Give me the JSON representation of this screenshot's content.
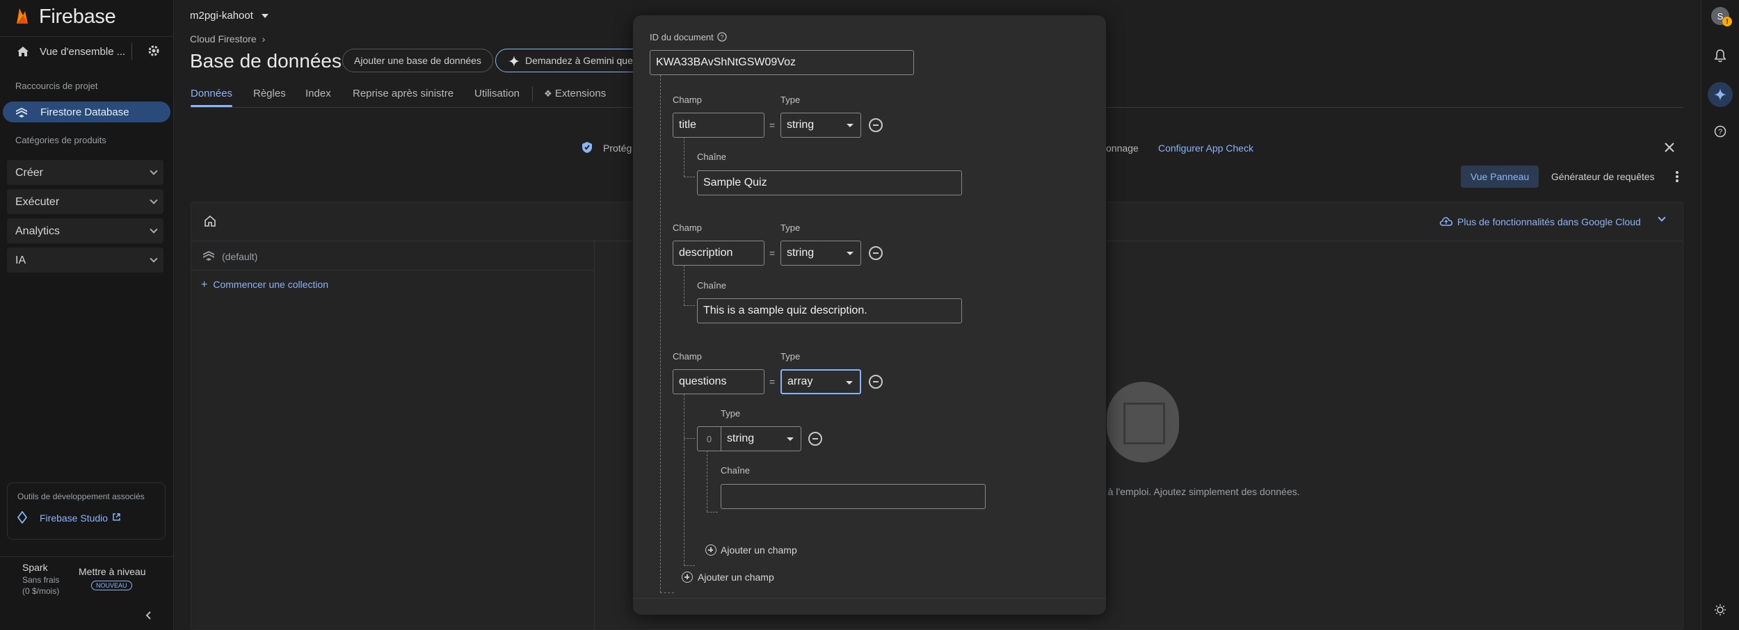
{
  "sidebar": {
    "logo": "Firebase",
    "overview": "Vue d'ensemble ...",
    "shortcuts_label": "Raccourcis de projet",
    "active_item": "Firestore Database",
    "categories_label": "Catégories de produits",
    "categories": [
      "Créer",
      "Exécuter",
      "Analytics",
      "IA"
    ],
    "dev_tools_label": "Outils de développement associés",
    "studio_link": "Firebase Studio",
    "plan_name": "Spark",
    "plan_price_1": "Sans frais",
    "plan_price_2": "(0 $/mois)",
    "upgrade": "Mettre à niveau",
    "new_badge": "NOUVEAU"
  },
  "header": {
    "project": "m2pgi-kahoot",
    "breadcrumb": "Cloud Firestore",
    "title": "Base de données",
    "add_db": "Ajouter une base de données",
    "gemini": "Demandez à Gemini que"
  },
  "tabs": [
    "Données",
    "Règles",
    "Index",
    "Reprise après sinistre",
    "Utilisation",
    "Extensions"
  ],
  "banner": {
    "left": "Protég",
    "right": "onnage",
    "link": "Configurer App Check"
  },
  "toolbar": {
    "panel_view": "Vue Panneau",
    "query_builder": "Générateur de requêtes",
    "cloud_link": "Plus de fonctionnalités dans Google Cloud"
  },
  "explorer": {
    "root": "(default)",
    "start_collection": "Commencer une collection",
    "empty_text": "e à l'emploi. Ajoutez simplement des données."
  },
  "dialog": {
    "doc_id_label": "ID du document",
    "doc_id": "KWA33BAvShNtGSW09Voz",
    "field_label": "Champ",
    "type_label": "Type",
    "value_label": "Chaîne",
    "fields": [
      {
        "name": "title",
        "type": "string",
        "value": "Sample Quiz"
      },
      {
        "name": "description",
        "type": "string",
        "value": "This is a sample quiz description."
      },
      {
        "name": "questions",
        "type": "array"
      }
    ],
    "array_item": {
      "index": "0",
      "type": "string",
      "value": ""
    },
    "add_field_inner": "Ajouter un champ",
    "add_field_outer": "Ajouter un champ"
  },
  "rail": {
    "avatar": "S"
  }
}
